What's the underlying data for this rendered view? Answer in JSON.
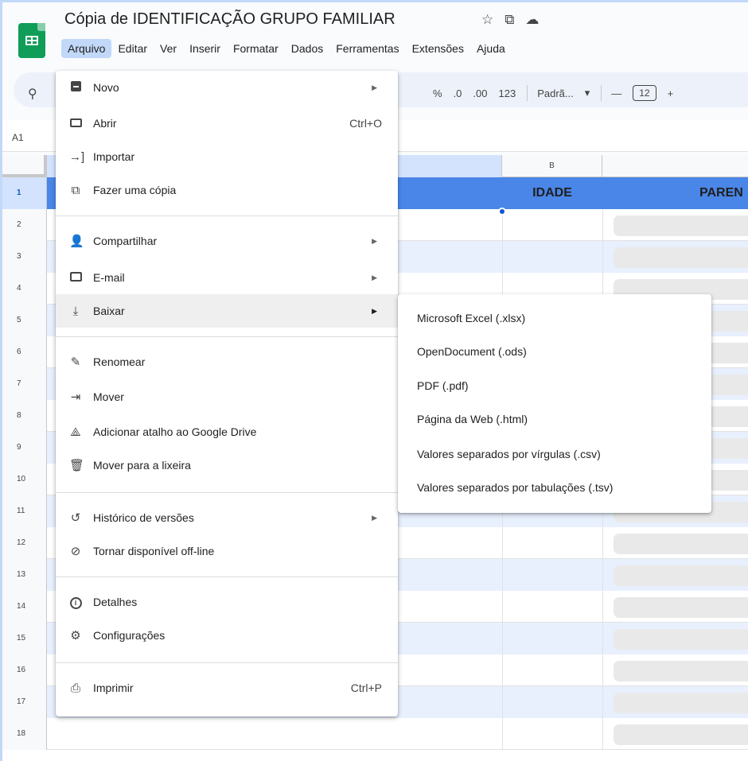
{
  "header": {
    "doc_title": "Cópia de IDENTIFICAÇÃO GRUPO FAMILIAR",
    "title_icons": [
      "star-icon",
      "move-folder-icon",
      "cloud-status-icon"
    ]
  },
  "menubar": {
    "items": [
      "Arquivo",
      "Editar",
      "Ver",
      "Inserir",
      "Formatar",
      "Dados",
      "Ferramentas",
      "Extensões",
      "Ajuda"
    ],
    "active": "Arquivo"
  },
  "toolbar": {
    "percent": "%",
    "decrease_decimal": ".0",
    "increase_decimal": ".00",
    "number_format": "123",
    "font_name": "Padrã...",
    "font_size": "12",
    "minus": "—",
    "plus": "+"
  },
  "namebox": {
    "cell": "A1"
  },
  "grid": {
    "col_b_header": "B",
    "header_row": {
      "b": "IDADE",
      "c": "PAREN"
    },
    "row_numbers": [
      "1",
      "2",
      "3",
      "4",
      "5",
      "6",
      "7",
      "8",
      "9",
      "10",
      "11",
      "12",
      "13",
      "14",
      "15",
      "16",
      "17",
      "18"
    ]
  },
  "file_menu": {
    "items": [
      {
        "icon": "new-sheet-icon",
        "label": "Novo",
        "shortcut": "",
        "submenu": true
      },
      {
        "icon": "folder-icon",
        "label": "Abrir",
        "shortcut": "Ctrl+O",
        "submenu": false
      },
      {
        "icon": "import-icon",
        "label": "Importar",
        "shortcut": "",
        "submenu": false
      },
      {
        "icon": "copy-icon",
        "label": "Fazer uma cópia",
        "shortcut": "",
        "submenu": false
      },
      {
        "icon": "share-icon",
        "label": "Compartilhar",
        "shortcut": "",
        "submenu": true
      },
      {
        "icon": "mail-icon",
        "label": "E-mail",
        "shortcut": "",
        "submenu": true
      },
      {
        "icon": "download-icon",
        "label": "Baixar",
        "shortcut": "",
        "submenu": true
      },
      {
        "icon": "rename-icon",
        "label": "Renomear",
        "shortcut": "",
        "submenu": false
      },
      {
        "icon": "move-icon",
        "label": "Mover",
        "shortcut": "",
        "submenu": false
      },
      {
        "icon": "drive-shortcut-icon",
        "label": "Adicionar atalho ao Google Drive",
        "shortcut": "",
        "submenu": false
      },
      {
        "icon": "trash-icon",
        "label": "Mover para a lixeira",
        "shortcut": "",
        "submenu": false
      },
      {
        "icon": "history-icon",
        "label": "Histórico de versões",
        "shortcut": "",
        "submenu": true
      },
      {
        "icon": "offline-icon",
        "label": "Tornar disponível off-line",
        "shortcut": "",
        "submenu": false
      },
      {
        "icon": "info-icon",
        "label": "Detalhes",
        "shortcut": "",
        "submenu": false
      },
      {
        "icon": "settings-icon",
        "label": "Configurações",
        "shortcut": "",
        "submenu": false
      },
      {
        "icon": "print-icon",
        "label": "Imprimir",
        "shortcut": "Ctrl+P",
        "submenu": false
      }
    ],
    "highlighted": "Baixar"
  },
  "download_submenu": {
    "items": [
      "Microsoft Excel (.xlsx)",
      "OpenDocument (.ods)",
      "PDF (.pdf)",
      "Página da Web (.html)",
      "Valores separados por vírgulas (.csv)",
      "Valores separados por tabulações (.tsv)"
    ]
  },
  "colors": {
    "accent": "#0b57d0",
    "header_fill": "#4a86e8",
    "menu_highlight": "#efefef",
    "frame": "#c2d8f9"
  }
}
